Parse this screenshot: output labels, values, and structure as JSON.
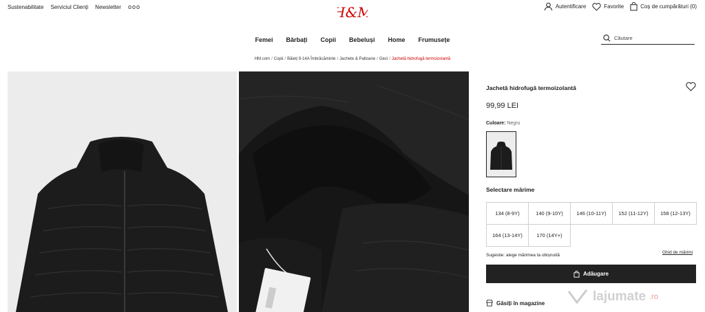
{
  "top_links": [
    "Sustenabilitate",
    "Serviciul Clienți",
    "Newsletter"
  ],
  "more_dots": "ooo",
  "logo_text": "H&M",
  "account": {
    "login": "Autentificare",
    "favorites": "Favorite",
    "cart": "Coș de cumpărături (0)"
  },
  "nav": [
    "Femei",
    "Bărbați",
    "Copii",
    "Bebeluși",
    "Home",
    "Frumusețe"
  ],
  "search": {
    "placeholder": "Căutare"
  },
  "breadcrumb": {
    "items": [
      "HM.com",
      "Copii",
      "Băieți 9-14A Îmbrăcăminte",
      "Jachete & Paltoane",
      "Geci"
    ],
    "current": "Jachetă hidrofugă termoizolantă",
    "separator": "/"
  },
  "product": {
    "name": "Jachetă hidrofugă termoizolantă",
    "price": "99,99 LEI",
    "color_label": "Culoare:",
    "color_value": "Negru",
    "size_title": "Selectare mărime",
    "sizes": [
      "134 (8-9Y)",
      "140 (9-10Y)",
      "146 (10-11Y)",
      "152 (11-12Y)",
      "158 (12-13Y)",
      "164 (13-14Y)",
      "170 (14Y+)"
    ],
    "suggestion": "Sugestie: alege mărimea ta obișnuită",
    "size_guide": "Ghid de mărimi",
    "add_button": "Adăugare",
    "find_in_store": "Găsiți în magazine"
  },
  "watermark": {
    "brand": "lajumate",
    "domain": ".ro"
  },
  "colors": {
    "accent": "#c00000",
    "button_bg": "#222222",
    "jacket": "#1c1c1c",
    "image_bg": "#ececec"
  }
}
